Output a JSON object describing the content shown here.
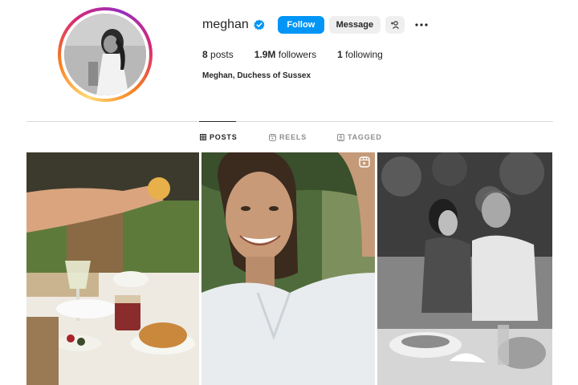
{
  "profile": {
    "username": "meghan",
    "verified": true,
    "follow_label": "Follow",
    "message_label": "Message",
    "full_name": "Meghan, Duchess of Sussex",
    "stats": {
      "posts_count": "8",
      "posts_label": "posts",
      "followers_count": "1.9M",
      "followers_label": "followers",
      "following_count": "1",
      "following_label": "following"
    }
  },
  "tabs": [
    {
      "label": "POSTS",
      "icon": "grid-icon",
      "active": true
    },
    {
      "label": "REELS",
      "icon": "reels-icon",
      "active": false
    },
    {
      "label": "TAGGED",
      "icon": "tagged-icon",
      "active": false
    }
  ],
  "posts": [
    {
      "description_icon": "photo-brunch-table",
      "reel": false
    },
    {
      "description_icon": "photo-selfie-smiling",
      "reel": true
    },
    {
      "description_icon": "photo-couple-kissing",
      "reel": false
    }
  ],
  "colors": {
    "accent": "#0095f6",
    "verified": "#0095f6",
    "text": "#262626",
    "muted": "#8e8e8e",
    "button_bg": "#efefef",
    "divider": "#dbdbdb"
  }
}
